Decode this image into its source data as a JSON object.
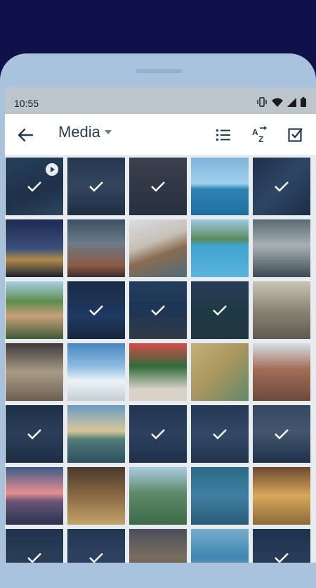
{
  "status_bar": {
    "time": "10:55"
  },
  "app_bar": {
    "title": "Media"
  },
  "colors": {
    "header_text": "#263c52",
    "status_bar": "#bcc4cc",
    "grid_bg": "#e8ecef"
  },
  "thumbnails": [
    {
      "name": "photo-city-aerial",
      "bg": "linear-gradient(160deg,#3d5c73,#2a3c4e 60%,#4b6b7c)",
      "selected": true,
      "video": true
    },
    {
      "name": "photo-sunset-clouds",
      "bg": "linear-gradient(180deg,#3a4a5f,#5b6b7d 50%,#2b3545)",
      "selected": true
    },
    {
      "name": "photo-building-facade",
      "bg": "linear-gradient(180deg,#6b5d55,#3e3a3b)",
      "selected": true
    },
    {
      "name": "photo-sea-rock",
      "bg": "linear-gradient(180deg,#7fb3da 0%,#9fd0ee 45%,#2f83b3 55%,#1f6d9e)",
      "selected": false
    },
    {
      "name": "photo-dark-lights",
      "bg": "linear-gradient(135deg,#2a3a55,#4e6a8a 50%,#253246)",
      "selected": true
    },
    {
      "name": "photo-night-city",
      "bg": "linear-gradient(180deg,#1e2a52,#3a4f7a 50%,#b08a4a 70%,#1a2030)",
      "selected": false
    },
    {
      "name": "photo-skyscraper-night",
      "bg": "linear-gradient(180deg,#3d4f63,#6b7a88 40%,#8a5a45 80%,#3a2e2e)",
      "selected": false
    },
    {
      "name": "photo-cliff-sea",
      "bg": "linear-gradient(160deg,#d8dde3,#c7bfb5 40%,#8a6b52 60%,#4d6d7b)",
      "selected": false
    },
    {
      "name": "photo-harbor-boats",
      "bg": "linear-gradient(180deg,#9cc9e6 0%,#5c8a5b 35%,#3ea3cf 45%,#5bb5dd)",
      "selected": false
    },
    {
      "name": "photo-stormy-sea",
      "bg": "linear-gradient(180deg,#5b6a75,#a8b0b3 45%,#3c4a55)",
      "selected": false
    },
    {
      "name": "photo-coastal-village",
      "bg": "linear-gradient(180deg,#a9cfe6 0%,#5c8d4f 35%,#c7a078 60%,#3e5b39)",
      "selected": false
    },
    {
      "name": "photo-night-reflection",
      "bg": "linear-gradient(180deg,#23304c,#2e4f83 60%,#1b2538)",
      "selected": true
    },
    {
      "name": "photo-rocky-coast",
      "bg": "linear-gradient(180deg,#35577c,#2a4667 50%,#5a5048)",
      "selected": true
    },
    {
      "name": "photo-green-hills",
      "bg": "linear-gradient(180deg,#3f566d,#2e4e45 55%,#2e4b3b)",
      "selected": true
    },
    {
      "name": "photo-old-street",
      "bg": "linear-gradient(180deg,#c9c4b4,#8a8574 50%,#5e5c50)",
      "selected": false
    },
    {
      "name": "photo-palace-hall",
      "bg": "linear-gradient(180deg,#3d3a3a,#a99c86 50%,#6b5f51)",
      "selected": false
    },
    {
      "name": "photo-snow-field",
      "bg": "linear-gradient(180deg,#4a86c2 0%,#8cbbe0 40%,#eef3f6 65%,#c4cfd6)",
      "selected": false
    },
    {
      "name": "photo-christmas-tree",
      "bg": "linear-gradient(180deg,#d64a4a,#2f6b3a 40%,#d9d2c8 80%)",
      "selected": false
    },
    {
      "name": "photo-board-game",
      "bg": "linear-gradient(135deg,#c2b278,#a8955f 50%,#5e8a6a)",
      "selected": false
    },
    {
      "name": "photo-rock-formation",
      "bg": "linear-gradient(180deg,#d7dfe6,#a36d57 45%,#6d4a3c)",
      "selected": false
    },
    {
      "name": "photo-dark-interior",
      "bg": "linear-gradient(180deg,#2c3a50,#4a5a70 50%,#263244)",
      "selected": true
    },
    {
      "name": "photo-beach-sunset",
      "bg": "linear-gradient(180deg,#6a9bc4,#d8c79a 45%,#4f7a78 60%,#2f5060)",
      "selected": false
    },
    {
      "name": "photo-dark-door",
      "bg": "linear-gradient(180deg,#334560,#4a5f7a 50%,#2a3a52)",
      "selected": true
    },
    {
      "name": "photo-table-top",
      "bg": "linear-gradient(180deg,#3a4c63,#56708e 50%,#334256)",
      "selected": true
    },
    {
      "name": "photo-mountain-mist",
      "bg": "linear-gradient(180deg,#5a6f87,#7f8fa0 45%,#2f3f53)",
      "selected": true
    },
    {
      "name": "photo-pink-sunset",
      "bg": "linear-gradient(180deg,#3d5a88,#e58f8f 45%,#6a5576 60%,#2a3350)",
      "selected": false
    },
    {
      "name": "photo-library-desk",
      "bg": "linear-gradient(180deg,#4a3a2e,#8a6a45 50%,#c4a26a)",
      "selected": false
    },
    {
      "name": "photo-mountain-valley",
      "bg": "linear-gradient(180deg,#a9cce2,#5f8a6a 45%,#3d6a4a)",
      "selected": false
    },
    {
      "name": "photo-boat-wake",
      "bg": "linear-gradient(180deg,#2b6a88,#3f7fa0 50%,#2a5c78)",
      "selected": false
    },
    {
      "name": "photo-cafe-food",
      "bg": "linear-gradient(180deg,#6b4a32,#d8a85a 50%,#8a6a3a)",
      "selected": false
    },
    {
      "name": "photo-dark-mountains",
      "bg": "linear-gradient(180deg,#2f4058,#45586f 50%,#27344a)",
      "selected": true
    },
    {
      "name": "photo-dark-landscape",
      "bg": "linear-gradient(180deg,#364a63,#4c6280 50%,#2b394f)",
      "selected": true
    },
    {
      "name": "photo-old-town",
      "bg": "linear-gradient(180deg,#4a4f5a,#7a6e60 50%,#3e3a38)",
      "selected": false
    },
    {
      "name": "photo-pool-reflection",
      "bg": "linear-gradient(180deg,#7aaccc,#3e86b0 50%,#c4b8a0)",
      "selected": false
    },
    {
      "name": "photo-dark-night",
      "bg": "linear-gradient(180deg,#2e4058,#40556e 50%,#253246)",
      "selected": true
    }
  ]
}
